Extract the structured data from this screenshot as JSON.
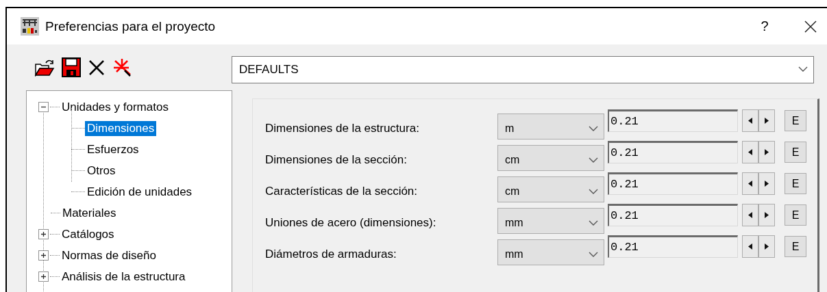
{
  "window": {
    "title": "Preferencias para el proyecto",
    "help": "?"
  },
  "preset": {
    "value": "DEFAULTS"
  },
  "tree": [
    {
      "label": "Unidades y formatos",
      "expanded": true,
      "selected": false,
      "children": [
        {
          "label": "Dimensiones",
          "selected": true
        },
        {
          "label": "Esfuerzos",
          "selected": false
        },
        {
          "label": "Otros",
          "selected": false
        },
        {
          "label": "Edición de unidades",
          "selected": false
        }
      ]
    },
    {
      "label": "Materiales",
      "selected": false
    },
    {
      "label": "Catálogos",
      "expanded": false,
      "selected": false
    },
    {
      "label": "Normas de diseño",
      "expanded": false,
      "selected": false
    },
    {
      "label": "Análisis de la estructura",
      "expanded": false,
      "selected": false
    }
  ],
  "settings": [
    {
      "label": "Dimensiones de la estructura:",
      "unit": "m",
      "value": "0.21",
      "button": "E"
    },
    {
      "label": "Dimensiones de la sección:",
      "unit": "cm",
      "value": "0.21",
      "button": "E"
    },
    {
      "label": "Características de la sección:",
      "unit": "cm",
      "value": "0.21",
      "button": "E"
    },
    {
      "label": "Uniones de acero (dimensiones):",
      "unit": "mm",
      "value": "0.21",
      "button": "E"
    },
    {
      "label": "Diámetros de armaduras:",
      "unit": "mm",
      "value": "0.21",
      "button": "E"
    }
  ]
}
